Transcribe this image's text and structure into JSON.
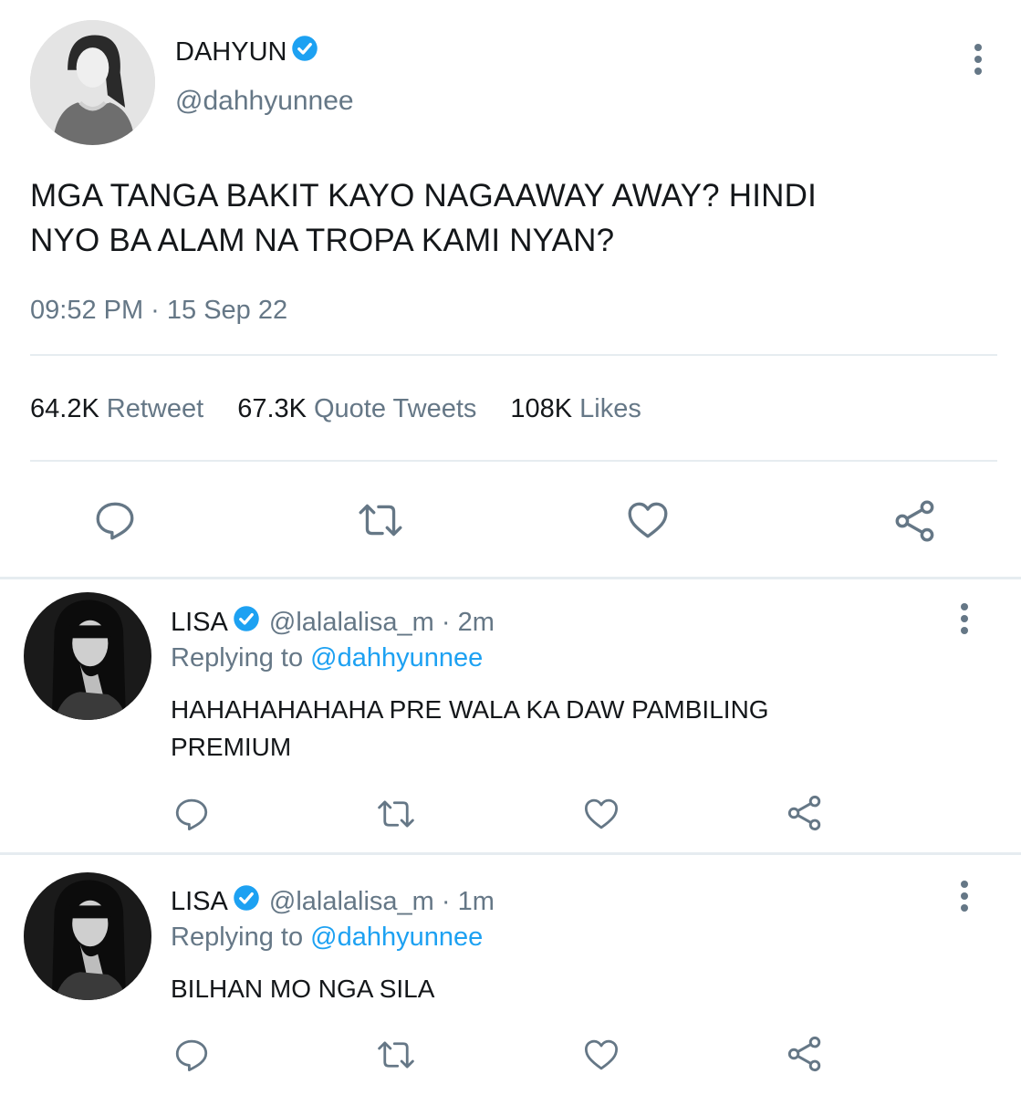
{
  "main_tweet": {
    "display_name": "DAHYUN",
    "handle": "@dahhyunnee",
    "text_line1": "MGA TANGA BAKIT KAYO NAGAAWAY AWAY? HINDI",
    "text_line2": "NYO BA ALAM NA TROPA KAMI NYAN?",
    "timestamp": "09:52 PM · 15 Sep 22",
    "stats": {
      "retweets_count": "64.2K",
      "retweets_label": "Retweet",
      "quotes_count": "67.3K",
      "quotes_label": "Quote Tweets",
      "likes_count": "108K",
      "likes_label": "Likes"
    },
    "actions": [
      "reply-icon",
      "retweet-icon",
      "like-icon",
      "share-icon"
    ]
  },
  "replies": [
    {
      "display_name": "LISA",
      "handle": "@lalalalisa_m · 2m",
      "replying_prefix": "Replying to",
      "replying_to": "@dahhyunnee",
      "text_line1": "HAHAHAHAHAHA PRE WALA KA DAW PAMBILING",
      "text_line2": "PREMIUM"
    },
    {
      "display_name": "LISA",
      "handle": "@lalalalisa_m · 1m",
      "replying_prefix": "Replying to",
      "replying_to": "@dahhyunnee",
      "text_line1": "BILHAN MO NGA SILA"
    }
  ],
  "colors": {
    "text": "#14171a",
    "secondary": "#657786",
    "accent": "#1da1f2",
    "divider": "#e6ecf0"
  }
}
